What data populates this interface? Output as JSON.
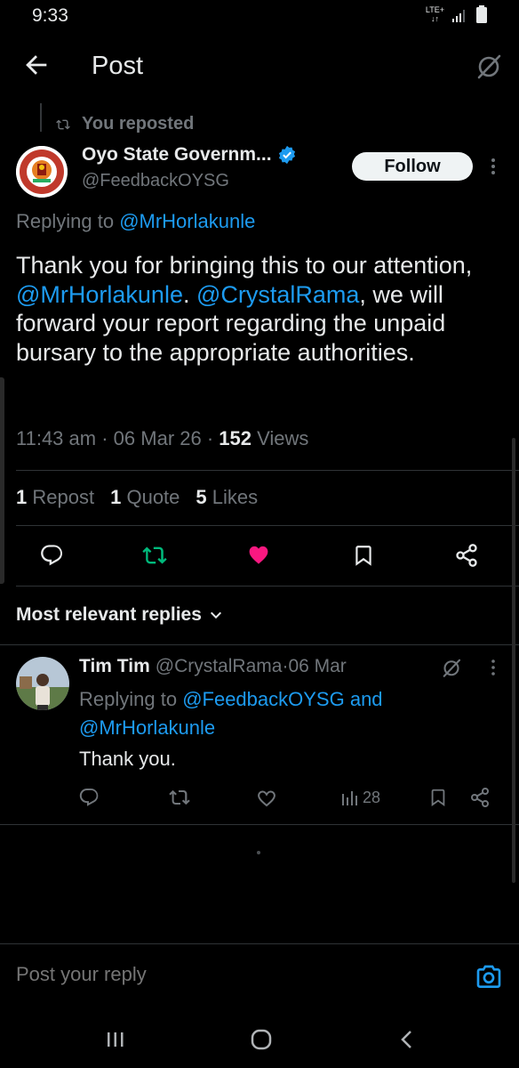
{
  "status_bar": {
    "time": "9:33",
    "network": "LTE+"
  },
  "header": {
    "title": "Post"
  },
  "repost": {
    "label": "You reposted"
  },
  "author": {
    "name": "Oyo State Governm...",
    "handle": "@FeedbackOYSG",
    "follow_label": "Follow"
  },
  "replying": {
    "prefix": "Replying to ",
    "mention": "@MrHorlakunle"
  },
  "post": {
    "text_1": "Thank you for bringing this to our attention, ",
    "mention_1": "@MrHorlakunle",
    "text_2": ". ",
    "mention_2": "@CrystalRama",
    "text_3": ", we will forward your report regarding the unpaid bursary to the appropriate authorities."
  },
  "meta": {
    "time": "11:43 am",
    "sep": " · ",
    "date": "06 Mar 26",
    "views_count": "152",
    "views_label": " Views"
  },
  "stats": {
    "reposts_count": "1",
    "reposts_label": "Repost",
    "quotes_count": "1",
    "quotes_label": "Quote",
    "likes_count": "5",
    "likes_label": "Likes"
  },
  "replies_section": {
    "sort_label": "Most relevant replies"
  },
  "reply": {
    "name": "Tim Tim",
    "handle": "@CrystalRama",
    "sep": " · ",
    "date": "06 Mar",
    "replying_prefix": "Replying to ",
    "mention_1": "@FeedbackOYSG",
    "and": " and ",
    "mention_2": "@MrHorlakunle",
    "text": "Thank you.",
    "views": "28"
  },
  "composer": {
    "placeholder": "Post your reply"
  },
  "colors": {
    "accent": "#1d9bf0",
    "like": "#f91880",
    "repost": "#00ba7c",
    "background": "#000000"
  }
}
